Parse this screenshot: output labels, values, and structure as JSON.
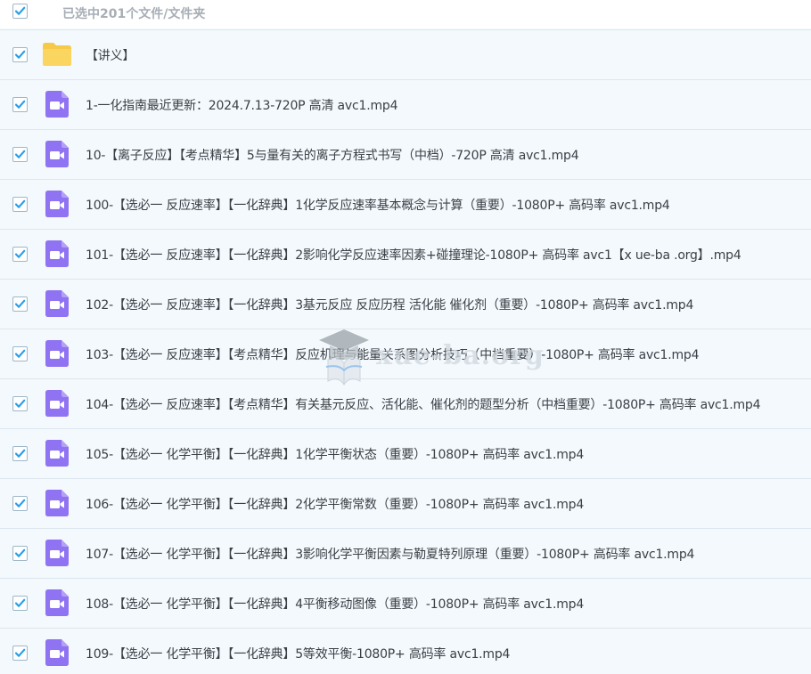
{
  "header": {
    "selection_text": "已选中201个文件/文件夹",
    "select_all_checked": true
  },
  "colors": {
    "checkmark": "#2b9ee8",
    "folder": "#f9d35c",
    "video_icon": "#8f73f2",
    "row_background": "#f3f9fd"
  },
  "files": [
    {
      "type": "folder",
      "icon": "folder-icon",
      "checked": true,
      "name": "【讲义】"
    },
    {
      "type": "video",
      "icon": "video-file-icon",
      "checked": true,
      "name": "1-一化指南最近更新：2024.7.13-720P 高清 avc1.mp4"
    },
    {
      "type": "video",
      "icon": "video-file-icon",
      "checked": true,
      "name": "10-【离子反应】【考点精华】5与量有关的离子方程式书写（中档）-720P 高清 avc1.mp4"
    },
    {
      "type": "video",
      "icon": "video-file-icon",
      "checked": true,
      "name": "100-【选必一 反应速率】【一化辞典】1化学反应速率基本概念与计算（重要）-1080P+ 高码率 avc1.mp4"
    },
    {
      "type": "video",
      "icon": "video-file-icon",
      "checked": true,
      "name": "101-【选必一 反应速率】【一化辞典】2影响化学反应速率因素+碰撞理论-1080P+ 高码率 avc1【x ue-ba .org】.mp4"
    },
    {
      "type": "video",
      "icon": "video-file-icon",
      "checked": true,
      "name": "102-【选必一 反应速率】【一化辞典】3基元反应 反应历程 活化能 催化剂（重要）-1080P+ 高码率 avc1.mp4"
    },
    {
      "type": "video",
      "icon": "video-file-icon",
      "checked": true,
      "name": "103-【选必一 反应速率】【考点精华】反应机理与能量关系图分析技巧（中档重要）-1080P+ 高码率 avc1.mp4"
    },
    {
      "type": "video",
      "icon": "video-file-icon",
      "checked": true,
      "name": "104-【选必一 反应速率】【考点精华】有关基元反应、活化能、催化剂的题型分析（中档重要）-1080P+ 高码率 avc1.mp4"
    },
    {
      "type": "video",
      "icon": "video-file-icon",
      "checked": true,
      "name": "105-【选必一 化学平衡】【一化辞典】1化学平衡状态（重要）-1080P+ 高码率 avc1.mp4"
    },
    {
      "type": "video",
      "icon": "video-file-icon",
      "checked": true,
      "name": "106-【选必一 化学平衡】【一化辞典】2化学平衡常数（重要）-1080P+ 高码率 avc1.mp4"
    },
    {
      "type": "video",
      "icon": "video-file-icon",
      "checked": true,
      "name": "107-【选必一 化学平衡】【一化辞典】3影响化学平衡因素与勒夏特列原理（重要）-1080P+ 高码率 avc1.mp4"
    },
    {
      "type": "video",
      "icon": "video-file-icon",
      "checked": true,
      "name": "108-【选必一 化学平衡】【一化辞典】4平衡移动图像（重要）-1080P+ 高码率 avc1.mp4"
    },
    {
      "type": "video",
      "icon": "video-file-icon",
      "checked": true,
      "name": "109-【选必一 化学平衡】【一化辞典】5等效平衡-1080P+ 高码率 avc1.mp4"
    }
  ],
  "watermark": {
    "text": "xue-ba.org"
  }
}
